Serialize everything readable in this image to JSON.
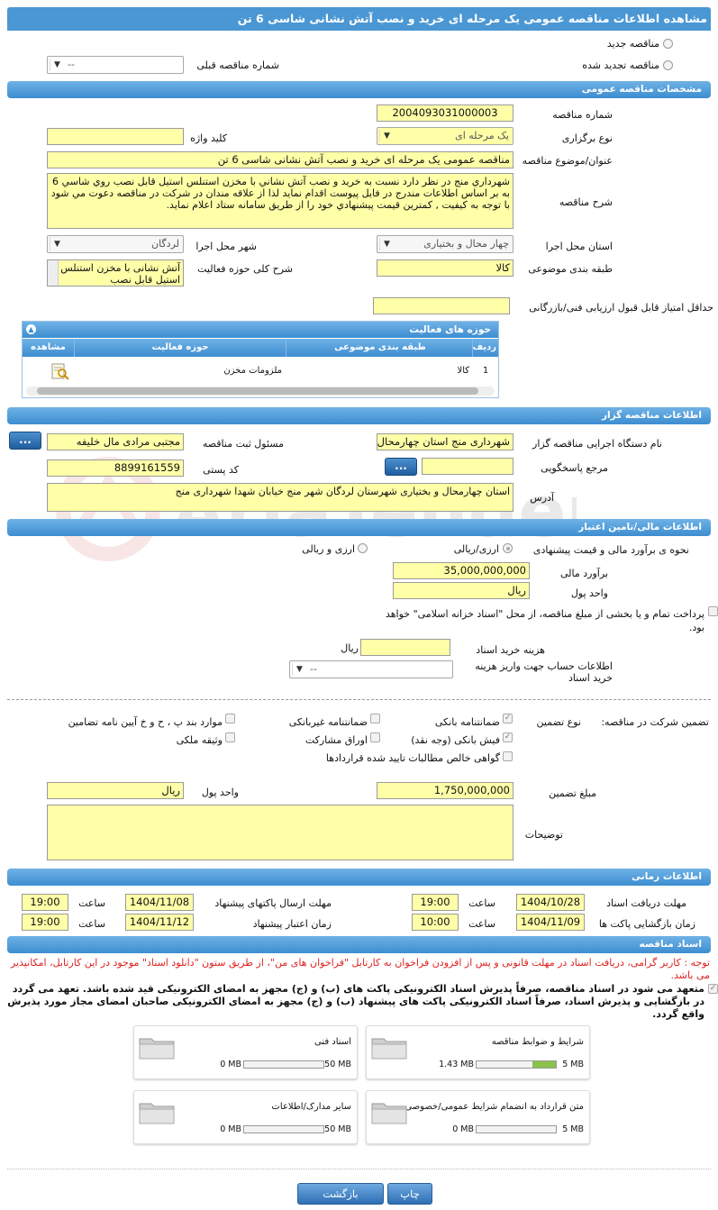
{
  "title": "مشاهده اطلاعات مناقصه عمومی یک مرحله ای خرید و نصب آتش نشانی شاسی 6 تن",
  "top": {
    "new_tender": "مناقصه جدید",
    "renewed_tender": "مناقصه تجدید شده",
    "prev_number_label": "شماره مناقصه قبلی",
    "prev_number_value": "--"
  },
  "general": {
    "section": "مشخصات مناقصه عمومی",
    "number_label": "شماره مناقصه",
    "number": "2004093031000003",
    "type_label": "نوع برگزاری",
    "type": "یک مرحله ای",
    "keyword_label": "کلید واژه",
    "keyword": "",
    "subject_label": "عنوان/موضوع مناقصه",
    "subject": "مناقصه عمومی یک مرحله ای خرید و نصب آتش نشانی شاسی 6 تن",
    "desc_label": "شرح مناقصه",
    "desc": "شهرداري منج در نظر دارد نسبت به خريد و نصب آتش نشاني با مخزن استنلس استيل قابل نصب روي شاسي 6  به بر اساس اطلاعات مندرج در فايل پيوست اقدام نمايد لذا از علاقه مندان در شرکت در مناقصه دعوت مي شود با توجه به کيفيت , کمترين قيمت پيشنهادي خود را از طريق سامانه ستاد اعلام نمايد.",
    "province_label": "استان محل اجرا",
    "province": "چهار محال و بختیاری",
    "city_label": "شهر محل اجرا",
    "city": "لردگان",
    "category_label": "طبقه بندی موضوعی",
    "category": "کالا",
    "scope_label": "شرح کلی حوزه فعالیت",
    "scope": "آتش نشانی با مخزن استنلس استیل قابل نصب",
    "min_score_label": "حداقل امتیاز قابل قبول ارزیابی فنی/بازرگانی",
    "min_score": ""
  },
  "activity": {
    "title": "حوزه های فعالیت",
    "headers": [
      "ردیف",
      "طبقه بندی موضوعی",
      "حوزه فعالیت",
      "مشاهده"
    ],
    "rows": [
      {
        "idx": "1",
        "category": "کالا",
        "field": "ملزومات مخزن"
      }
    ]
  },
  "organizer": {
    "section": "اطلاعات مناقصه گزار",
    "org_label": "نام دستگاه اجرایی مناقصه گزار",
    "org": "شهرداری منج استان چهارمحال",
    "registrar_label": "مسئول ثبت مناقصه",
    "registrar": "مجتبی مرادی مال خلیفه",
    "ref_label": "مرجع پاسخگویی",
    "ref": "",
    "postal_label": "کد پستی",
    "postal": "8899161559",
    "address_label": "آدرس",
    "address": "استان چهارمحال و بختیاری شهرستان لردگان شهر منج خیابان شهدا شهرداری منج",
    "dots": "..."
  },
  "finance": {
    "section": "اطلاعات مالی/تامین اعتبار",
    "method_label": "نحوه ی برآورد مالی و قیمت پیشنهادی",
    "opt1": "ارزی/ریالی",
    "opt2": "ارزی و ریالی",
    "estimate_label": "برآورد مالی",
    "estimate": "35,000,000,000",
    "currency_label": "واحد پول",
    "currency": "ریال",
    "treasury": "پرداخت تمام و یا بخشی از مبلغ مناقصه، از محل \"اسناد خزانه اسلامی\" خواهد بود.",
    "doc_cost_label": "هزینه خرید اسناد",
    "doc_cost": "",
    "doc_cost_unit": "ریال",
    "account_label": "اطلاعات حساب جهت واریز هزینه خرید اسناد",
    "account": "--"
  },
  "guarantee": {
    "participation_label": "تضمین شرکت در مناقصه:",
    "type_label": "نوع تضمین",
    "bank_guarantee": "ضمانتنامه بانکی",
    "nonbank_guarantee": "ضمانتنامه غیربانکی",
    "items_bcd": "موارد بند پ ، ح و خ آیین نامه تضامین",
    "bank_receipt": "فیش بانکی (وجه نقد)",
    "bonds": "اوراق مشارکت",
    "property": "وثیقه ملکی",
    "claims": "گواهی خالص مطالبات تایید شده قراردادها",
    "amount_label": "مبلغ تضمین",
    "amount": "1,750,000,000",
    "unit_label": "واحد پول",
    "unit": "ریال",
    "notes_label": "توضیحات",
    "notes": ""
  },
  "timing": {
    "section": "اطلاعات زمانی",
    "doc_receive_label": "مهلت دریافت اسناد",
    "doc_receive_date": "1404/10/28",
    "doc_receive_time": "19:00",
    "send_label": "مهلت ارسال پاکتهای پیشنهاد",
    "send_date": "1404/11/08",
    "send_time": "19:00",
    "open_label": "زمان بازگشایی پاکت ها",
    "open_date": "1404/11/09",
    "open_time": "10:00",
    "validity_label": "زمان اعتبار پیشنهاد",
    "validity_date": "1404/11/12",
    "validity_time": "19:00",
    "time_label": "ساعت"
  },
  "docs": {
    "section": "اسناد مناقصه",
    "notice": "توجه : کاربر گرامی، دریافت اسناد در مهلت قانونی و پس از افزودن فراخوان به کارتابل \"فراخوان های من\"، از طریق ستون \"دانلود اسناد\" موجود در این کارتابل، امکانپذیر می باشد.",
    "commit": "متعهد می شود در اسناد مناقصه، صرفاً پذیرش اسناد الکترونیکی پاکت های (ب) و (ج) مجهز به امضای الکترونیکی قید شده باشد. تعهد می گردد در بازگشایی و پذیرش اسناد، صرفاً اسناد الکترونیکی پاکت های پیشنهاد (ب) و (ج) مجهز به امضای الکترونیکی صاحبان امضای مجاز مورد پذیرش واقع گردد.",
    "files": [
      {
        "name": "شرایط و ضوابط مناقصه",
        "used": "1.43 MB",
        "max": "5 MB",
        "fill": 0.29
      },
      {
        "name": "اسناد فنی",
        "used": "0 MB",
        "max": "50 MB",
        "fill": 0
      },
      {
        "name": "متن قرارداد به انضمام شرایط عمومی/خصوصی",
        "used": "0 MB",
        "max": "5 MB",
        "fill": 0
      },
      {
        "name": "سایر مدارک/اطلاعات",
        "used": "0 MB",
        "max": "50 MB",
        "fill": 0
      }
    ]
  },
  "buttons": {
    "print": "چاپ",
    "back": "بازگشت"
  },
  "watermark": "AriaTender.neT"
}
